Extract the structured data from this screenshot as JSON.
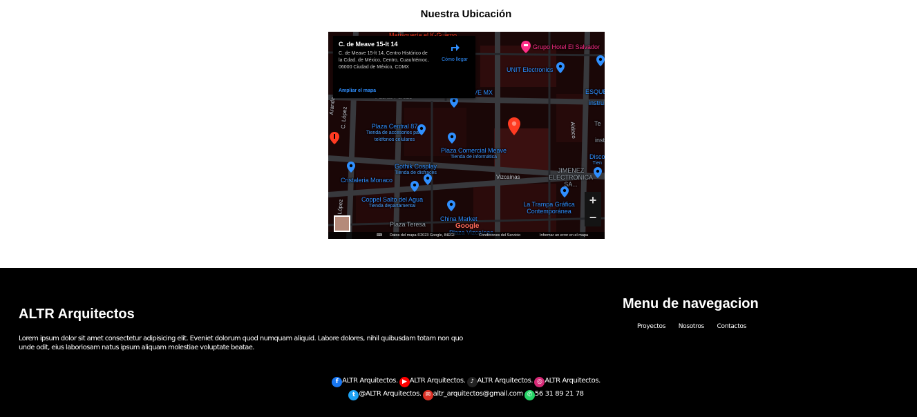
{
  "location_section": {
    "title": "Nuestra Ubicación"
  },
  "map": {
    "info_card": {
      "title": "C. de Meave 15-lt 14",
      "address": "C. de Meave 15-lt 14, Centro Histórico de la Cdad. de México, Centro, Cuauhtémoc, 06000 Ciudad de México, CDMX",
      "directions_label": "Cómo llegar",
      "enlarge_link": "Ampliar el mapa"
    },
    "zoom_in": "+",
    "zoom_out": "−",
    "logo": "Google",
    "attribution": {
      "keyboard": "⌨",
      "data": "Datos del mapa ©2023 Google, INEGI",
      "terms": "Condiciones del Servicio",
      "report": "Informar un error en el mapa"
    },
    "places": {
      "marisqueria": "Marisquería el K-Guamo",
      "hotel": "Grupo Hotel El Salvador",
      "unit": "UNIT Electronics",
      "wave": "VE MX",
      "esque": "ESQUE",
      "instru": "instru",
      "plaza_central": "Plaza Central 87",
      "plaza_central_sub": "Tienda de accesorios para teléfonos celulares",
      "plaza_comercial": "Plaza Comercial Meave",
      "plaza_comercial_sub": "Tienda de informática",
      "gothik": "Gothik Cosplay",
      "gothik_sub": "Tienda de disfraces",
      "cristaleria": "Cristaleria Monaco",
      "coppel": "Coppel Salto del Agua",
      "coppel_sub": "Tienda departamental",
      "china": "China Market",
      "plaza_teresa": "Plaza Teresa",
      "la_trampa": "La Trampa Gráfica Contemporánea",
      "jimenez": "JIMENEZ ELECTRONICA SA...",
      "disco": "Disco",
      "disco_sub": "Tien",
      "te": "Te",
      "inst": "inst",
      "plaza_vizcainas": "Plaza Vizcaínas"
    },
    "streets": {
      "puente_peredo": "Puente Peredo",
      "c_lopez": "C. López",
      "aranda": "Aranda",
      "vizcainas": "Vizcaínas",
      "aldaco": "Aldaco",
      "lopez": "López"
    }
  },
  "footer": {
    "brand": "ALTR Arquitectos",
    "description": "Lorem ipsum dolor sit amet consectetur adipisicing elit. Eveniet dolorum quod numquam aliquid. Labore dolores, nihil quibusdam totam non quo unde odit, eius laboriosam natus ipsum aliquam molestiae voluptate beatae.",
    "nav_heading": "Menu de navegacion",
    "nav_links": [
      "Proyectos",
      "Nosotros",
      "Contactos"
    ],
    "social_row1": [
      {
        "icon": "facebook-icon",
        "label": "ALTR Arquitectos.",
        "color": "#1877f2",
        "glyph": "f"
      },
      {
        "icon": "youtube-icon",
        "label": "ALTR Arquitectos.",
        "color": "#ff0000",
        "glyph": "▶"
      },
      {
        "icon": "tiktok-icon",
        "label": "ALTR Arquitectos.",
        "color": "#222222",
        "glyph": "♪"
      },
      {
        "icon": "instagram-icon",
        "label": "ALTR Arquitectos.",
        "color": "#d62976",
        "glyph": "◎"
      }
    ],
    "social_row2": [
      {
        "icon": "twitter-icon",
        "label": "@ALTR Arquitectos.",
        "color": "#1da1f2",
        "glyph": "t"
      },
      {
        "icon": "email-icon",
        "label": "altr_arquitectos@gmail.com",
        "color": "#d93025",
        "glyph": "✉"
      },
      {
        "icon": "whatsapp-icon",
        "label": "56 31 89 21 78",
        "color": "#25d366",
        "glyph": "✆"
      }
    ]
  }
}
